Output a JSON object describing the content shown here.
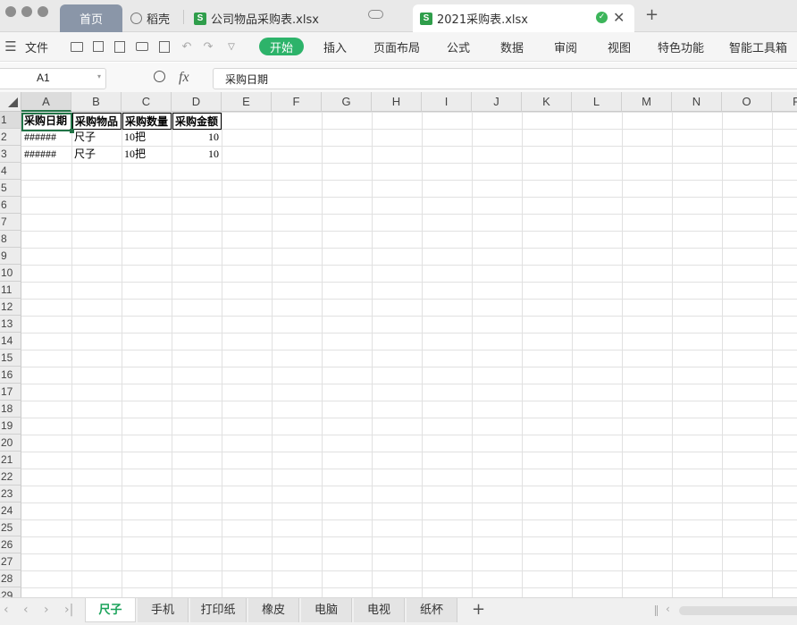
{
  "window_tabs": [
    {
      "label": "首页"
    },
    {
      "label": "稻壳"
    },
    {
      "label": "公司物品采购表.xlsx"
    },
    {
      "label": "2021采购表.xlsx"
    }
  ],
  "new_tab": "+",
  "menu": {
    "file": "文件",
    "start": "开始",
    "items": [
      "插入",
      "页面布局",
      "公式",
      "数据",
      "审阅",
      "视图",
      "特色功能",
      "智能工具箱"
    ]
  },
  "formula": {
    "cell_ref": "A1",
    "fx": "fx",
    "content": "采购日期"
  },
  "columns": [
    "A",
    "B",
    "C",
    "D",
    "E",
    "F",
    "G",
    "H",
    "I",
    "J",
    "K",
    "L",
    "M",
    "N",
    "O",
    "P"
  ],
  "rows": [
    "1",
    "2",
    "3",
    "4",
    "5",
    "6",
    "7",
    "8",
    "9",
    "10",
    "11",
    "12",
    "13",
    "14",
    "15",
    "16",
    "17",
    "18",
    "19",
    "20",
    "21",
    "22",
    "23",
    "24",
    "25",
    "26",
    "27",
    "28",
    "29"
  ],
  "cells": {
    "headers": [
      "采购日期",
      "采购物品",
      "采购数量",
      "采购金额"
    ],
    "row2": [
      "######",
      "尺子",
      "10把",
      "10"
    ],
    "row3": [
      "######",
      "尺子",
      "10把",
      "10"
    ]
  },
  "sheets": [
    "尺子",
    "手机",
    "打印纸",
    "橡皮",
    "电脑",
    "电视",
    "纸杯"
  ],
  "add_sheet": "+",
  "colors": {
    "accent": "#2db36a",
    "active_sheet": "#1aa35a",
    "selection": "#217346"
  }
}
